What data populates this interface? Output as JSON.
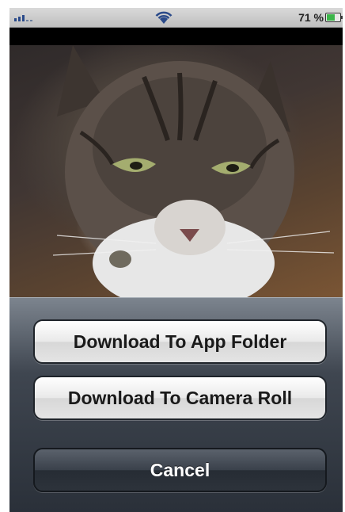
{
  "status_bar": {
    "battery_percent": "71 %",
    "battery_level": 0.71,
    "signal_icon": "signal-bars-icon",
    "wifi_icon": "wifi-icon"
  },
  "photo": {
    "subject": "cat-photo"
  },
  "action_sheet": {
    "buttons": [
      {
        "label": "Download To App Folder"
      },
      {
        "label": "Download To Camera Roll"
      }
    ],
    "cancel_label": "Cancel"
  },
  "colors": {
    "sheet_top": "#7c848e",
    "sheet_bottom": "#2a3039",
    "battery_fill": "#3cb54a"
  }
}
